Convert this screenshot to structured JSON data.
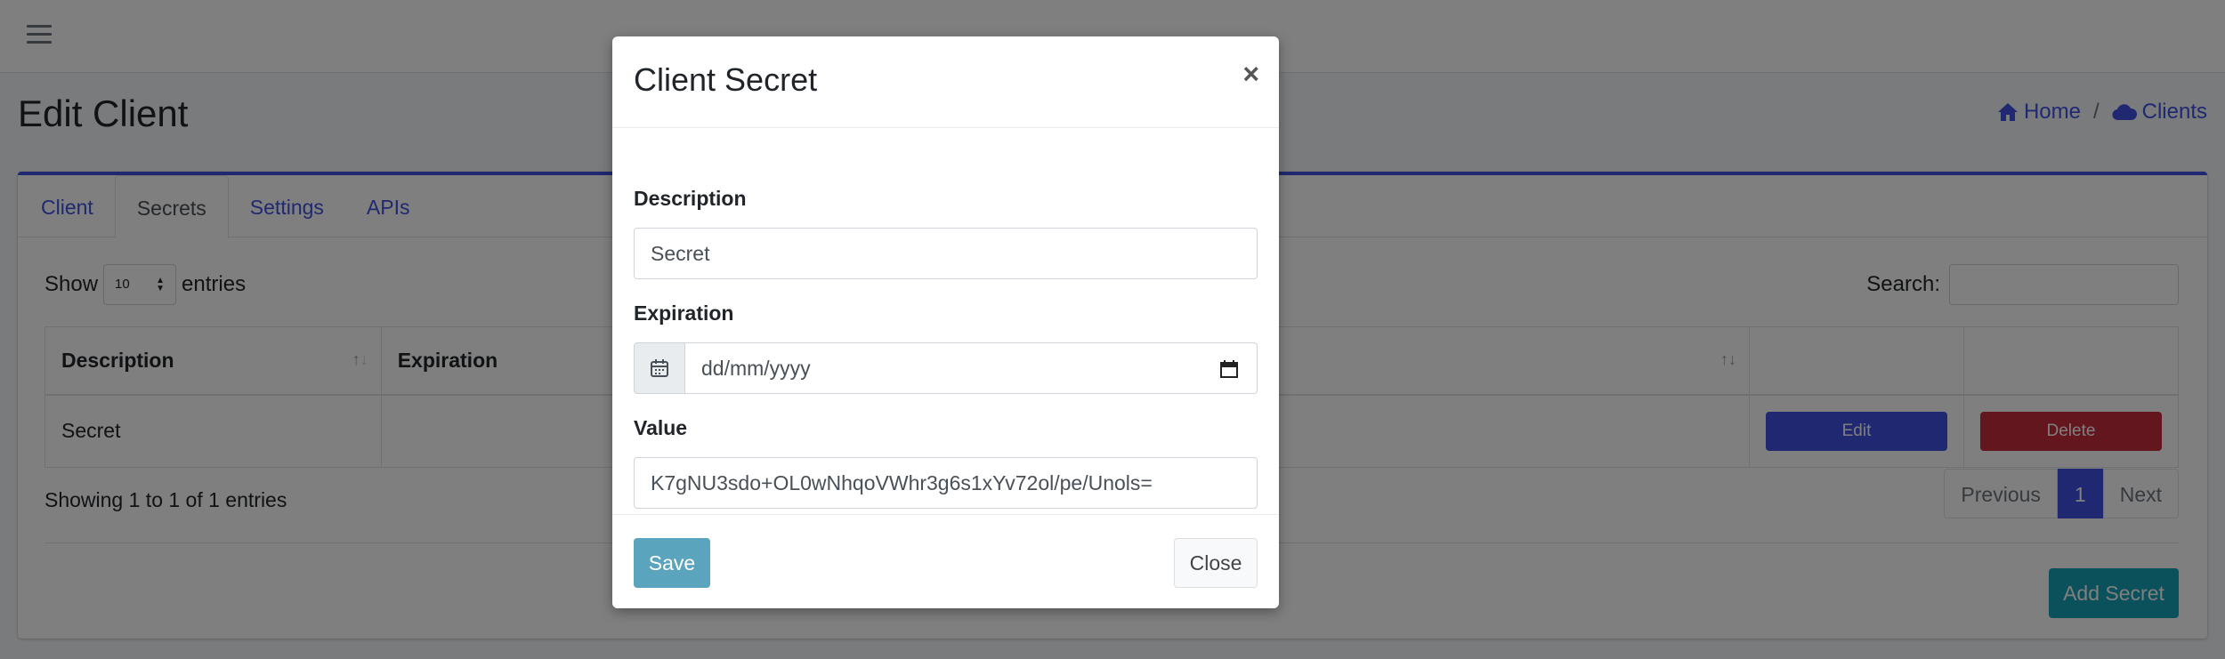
{
  "header": {
    "title": "Edit Client"
  },
  "breadcrumb": {
    "home": "Home",
    "separator": "/",
    "clients": "Clients"
  },
  "tabs": [
    {
      "label": "Client",
      "active": false
    },
    {
      "label": "Secrets",
      "active": true
    },
    {
      "label": "Settings",
      "active": false
    },
    {
      "label": "APIs",
      "active": false
    }
  ],
  "table_controls": {
    "show_label": "Show",
    "page_length": "10",
    "entries_label": "entries",
    "search_label": "Search:",
    "search_value": ""
  },
  "table": {
    "headers": [
      "Description",
      "Expiration",
      "",
      "",
      ""
    ],
    "rows": [
      {
        "description": "Secret",
        "expiration": "",
        "edit_label": "Edit",
        "delete_label": "Delete"
      }
    ]
  },
  "info": "Showing 1 to 1 of 1 entries",
  "pagination": {
    "previous": "Previous",
    "current": "1",
    "next": "Next"
  },
  "add_secret_label": "Add Secret",
  "modal": {
    "title": "Client Secret",
    "close_symbol": "×",
    "description_label": "Description",
    "description_value": "Secret",
    "expiration_label": "Expiration",
    "expiration_placeholder": "dd/mm/yyyy",
    "value_label": "Value",
    "value_value": "K7gNU3sdo+OL0wNhqoVWhr3g6s1xYv72ol/pe/Unols=",
    "save_label": "Save",
    "close_label": "Close"
  },
  "colors": {
    "accent": "#3f51e0",
    "danger": "#c72c3a",
    "info": "#17a2b8",
    "save": "#5ba4bd"
  }
}
